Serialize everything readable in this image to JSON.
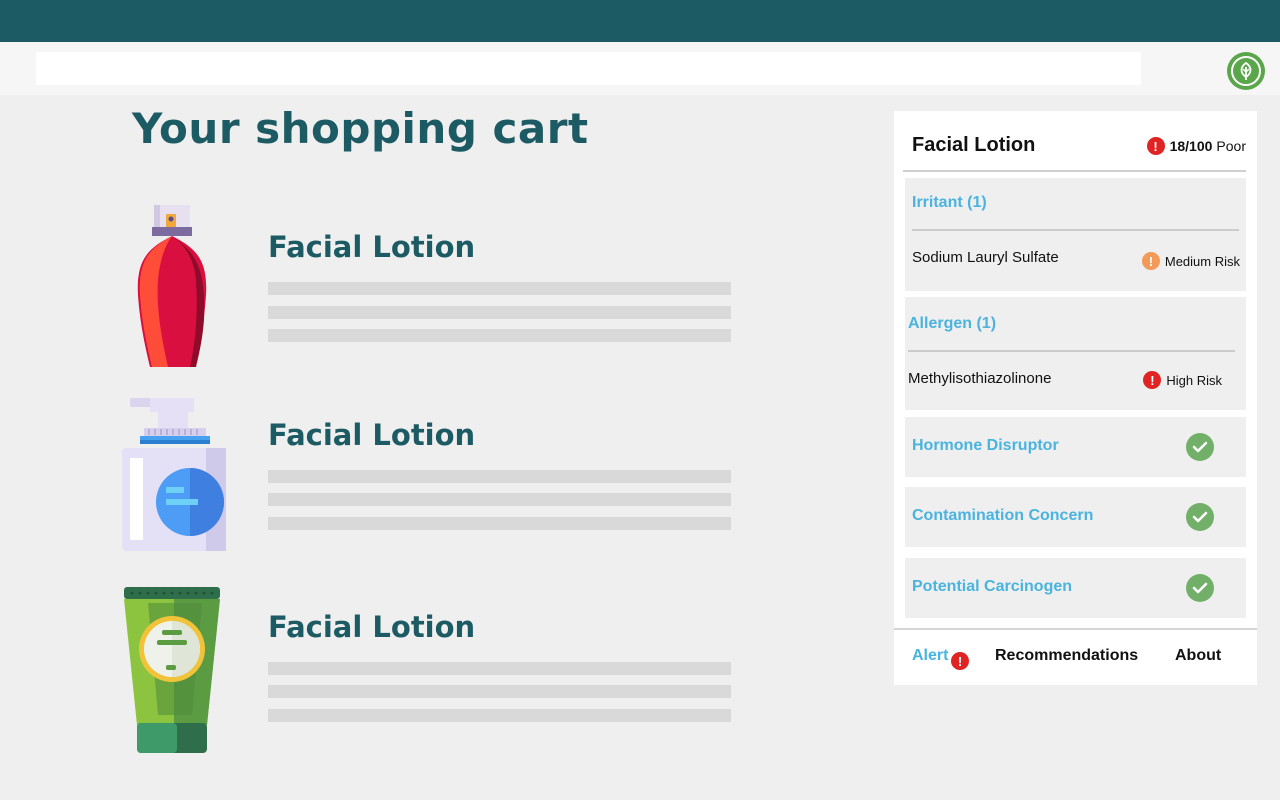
{
  "header": {
    "brand_color": "#1c5b63"
  },
  "browser": {
    "url_placeholder": "",
    "extension_icon": "leaf-icon"
  },
  "cart": {
    "title": "Your shopping cart",
    "items": [
      {
        "name": "Facial Lotion",
        "image": "perfume-spray-bottle-icon"
      },
      {
        "name": "Facial Lotion",
        "image": "pump-dispenser-bottle-icon"
      },
      {
        "name": "Facial Lotion",
        "image": "cream-tube-icon"
      }
    ]
  },
  "panel": {
    "product_name": "Facial Lotion",
    "score_value": "18/100",
    "score_label": "Poor",
    "score_icon": "alert-icon",
    "categories": [
      {
        "title": "Irritant (1)",
        "ingredient": "Sodium Lauryl Sulfate",
        "risk": "Medium Risk",
        "risk_color": "#f39a58"
      },
      {
        "title": "Allergen (1)",
        "ingredient": "Methylisothiazolinone",
        "risk": "High Risk",
        "risk_color": "#e02424"
      },
      {
        "title": "Hormone Disruptor",
        "status": "check-icon"
      },
      {
        "title": "Contamination Concern",
        "status": "check-icon"
      },
      {
        "title": "Potential Carcinogen",
        "status": "check-icon"
      }
    ],
    "tabs": [
      {
        "label": "Alert",
        "active": true,
        "badge": "!"
      },
      {
        "label": "Recommendations",
        "active": false
      },
      {
        "label": "About",
        "active": false
      }
    ]
  },
  "colors": {
    "accent_blue": "#4ab3de",
    "risk_high": "#e02424",
    "risk_medium": "#f39a58",
    "ok_green": "#72b069",
    "extension_green": "#5aa64a"
  }
}
